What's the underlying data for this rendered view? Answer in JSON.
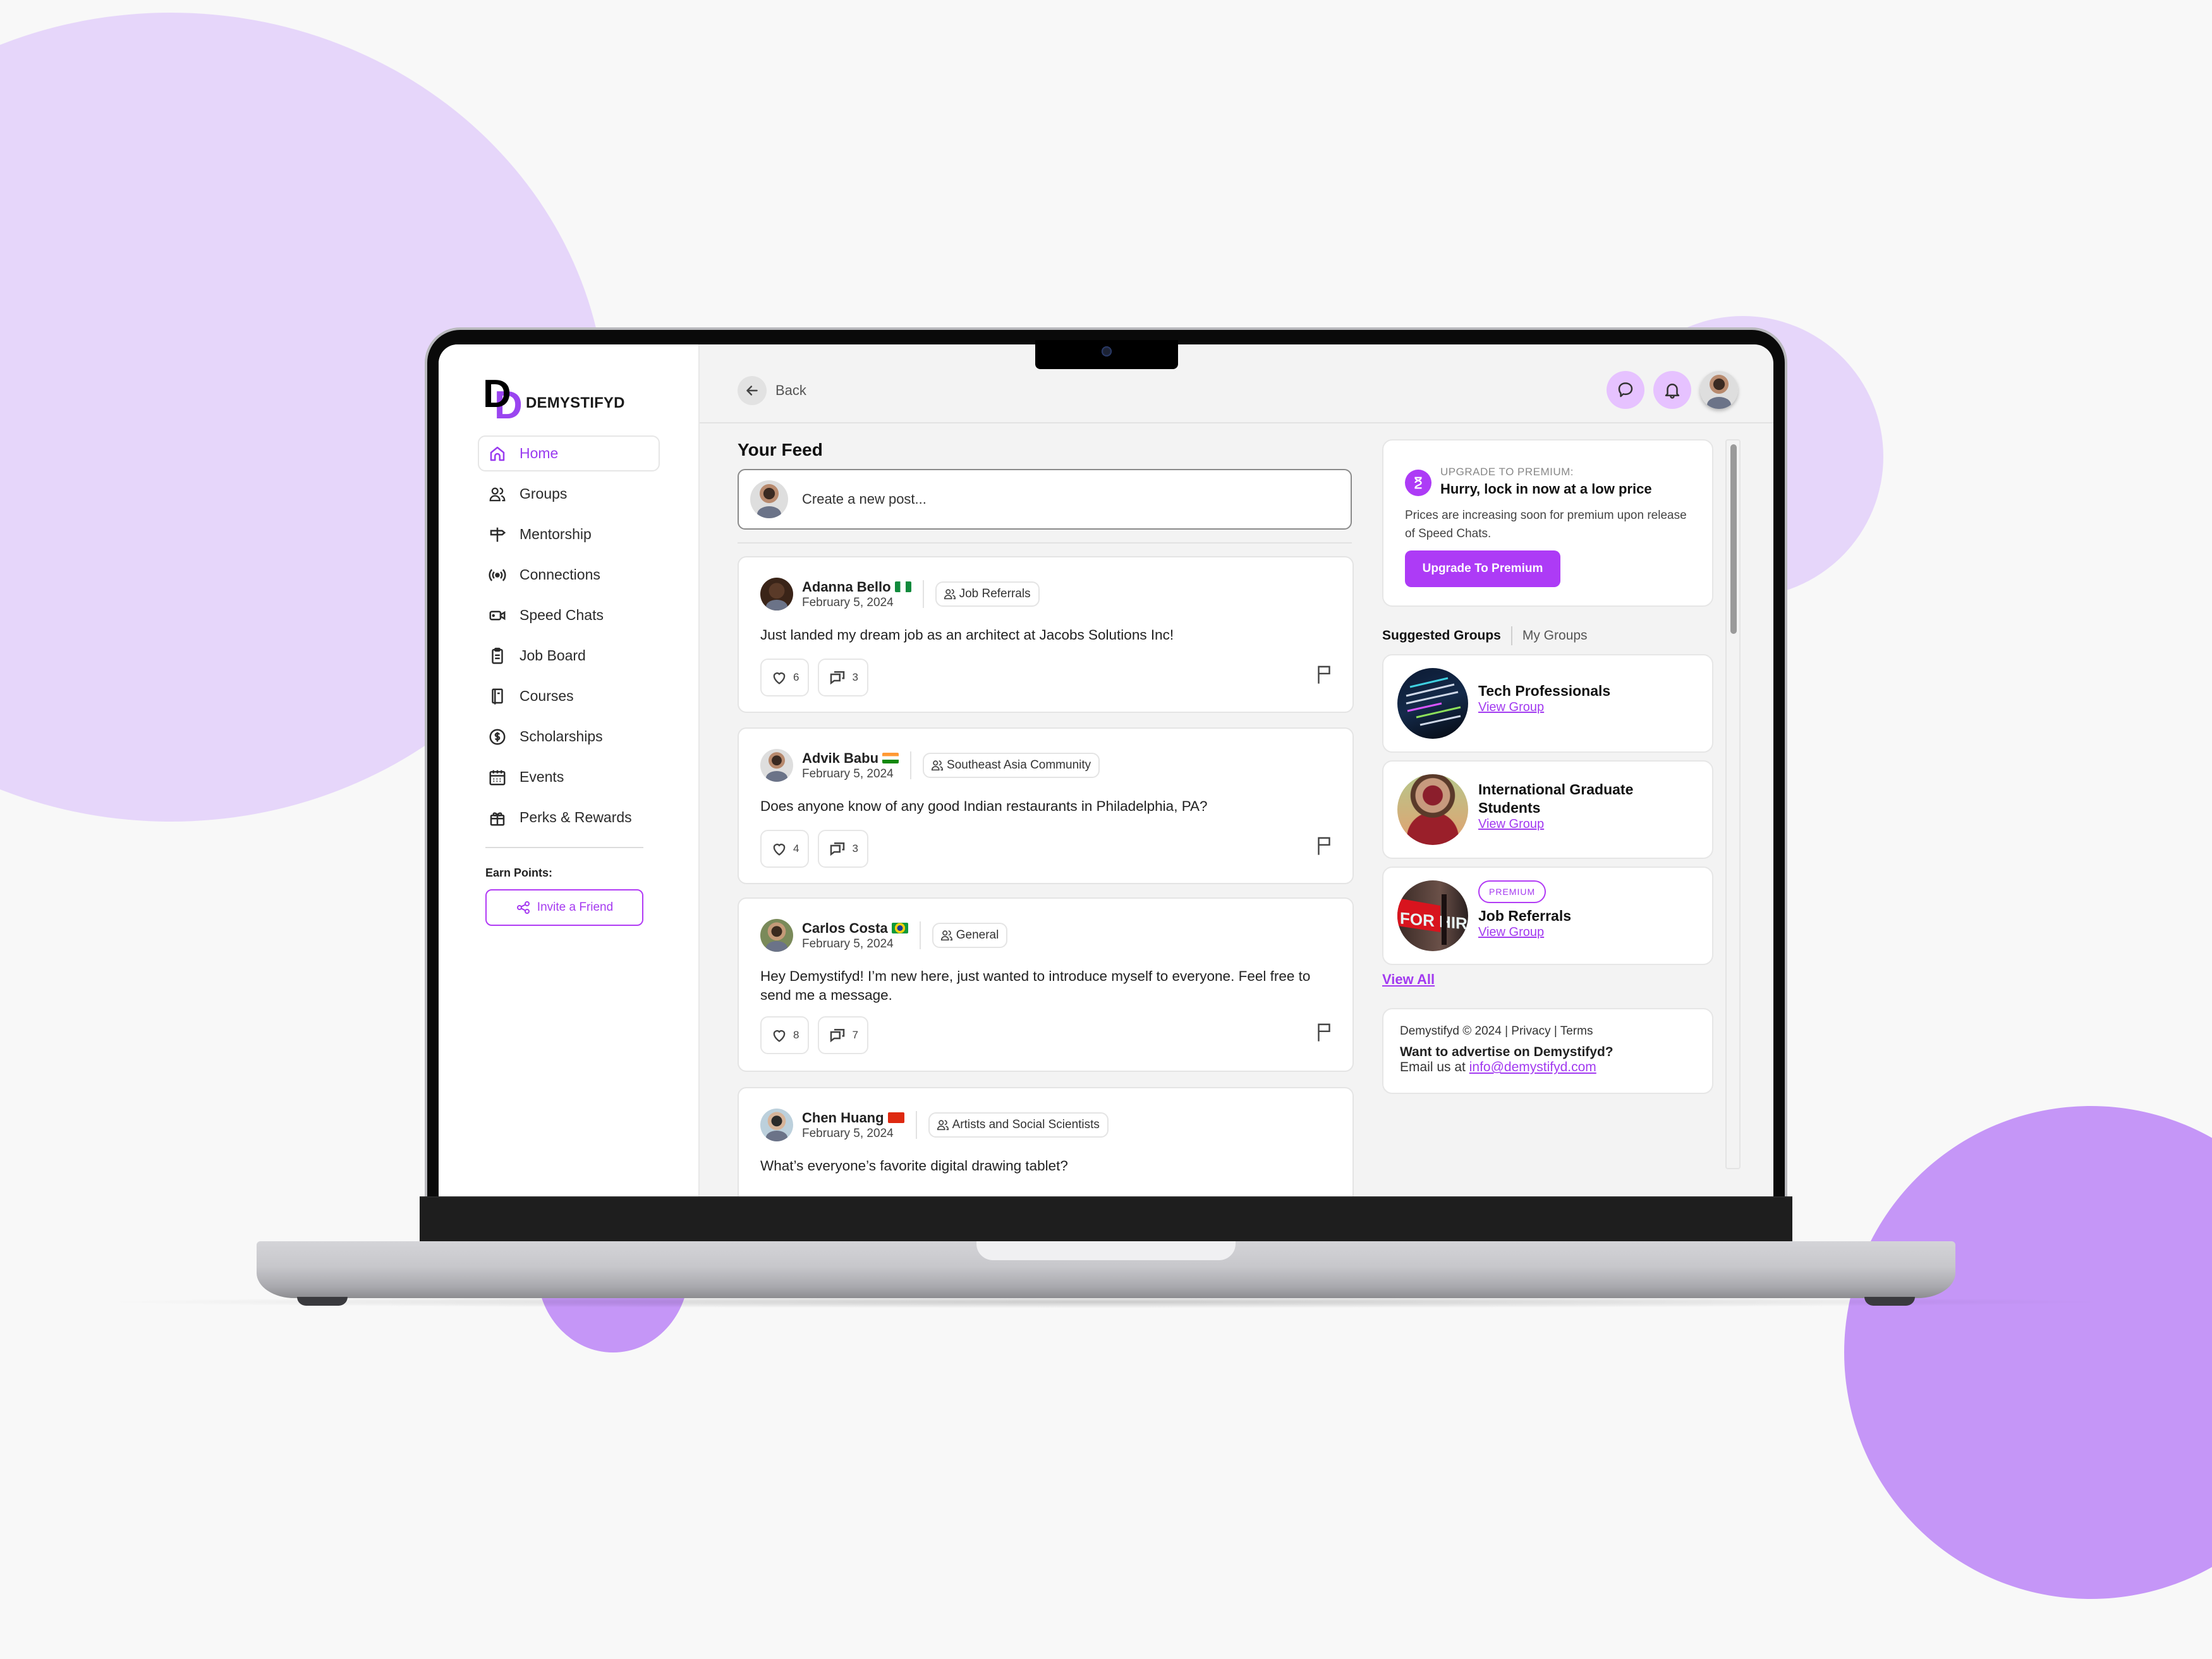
{
  "app": {
    "brand": "DEMYSTIFYD",
    "accent_color": "#ad3bf6",
    "light_accent": "#e6c2ff"
  },
  "sidebar": {
    "items": [
      {
        "label": "Home",
        "icon": "home-icon",
        "active": true
      },
      {
        "label": "Groups",
        "icon": "groups-icon"
      },
      {
        "label": "Mentorship",
        "icon": "signpost-icon"
      },
      {
        "label": "Connections",
        "icon": "broadcast-icon"
      },
      {
        "label": "Speed Chats",
        "icon": "video-icon"
      },
      {
        "label": "Job Board",
        "icon": "clipboard-icon"
      },
      {
        "label": "Courses",
        "icon": "book-icon"
      },
      {
        "label": "Scholarships",
        "icon": "dollar-icon"
      },
      {
        "label": "Events",
        "icon": "calendar-icon"
      },
      {
        "label": "Perks & Rewards",
        "icon": "gift-icon"
      }
    ],
    "earn_points_label": "Earn Points:",
    "invite_label": "Invite a Friend"
  },
  "header": {
    "back_label": "Back"
  },
  "feed": {
    "title": "Your Feed",
    "create_placeholder": "Create a new post...",
    "posts": [
      {
        "author": "Adanna Bello",
        "flag": "Nigeria",
        "date": "February 5, 2024",
        "group": "Job Referrals",
        "text": "Just landed my dream job as an architect at Jacobs Solutions Inc!",
        "likes": "6",
        "comments": "3"
      },
      {
        "author": "Advik Babu",
        "flag": "India",
        "date": "February 5, 2024",
        "group": "Southeast Asia Community",
        "text": "Does anyone know of any good Indian restaurants in Philadelphia, PA?",
        "likes": "4",
        "comments": "3"
      },
      {
        "author": "Carlos Costa",
        "flag": "Brazil",
        "date": "February 5, 2024",
        "group": "General",
        "text": "Hey Demystifyd! I’m new here, just wanted to introduce myself to everyone. Feel free to send me a message.",
        "likes": "8",
        "comments": "7"
      },
      {
        "author": "Chen Huang",
        "flag": "China",
        "date": "February 5, 2024",
        "group": "Artists and Social Scientists",
        "text": "What’s everyone’s favorite digital drawing tablet?"
      }
    ]
  },
  "promo": {
    "kicker": "UPGRADE TO PREMIUM:",
    "title": "Hurry, lock in now at a low price",
    "text": "Prices are increasing soon for premium upon release of Speed Chats.",
    "button": "Upgrade To Premium"
  },
  "groups": {
    "tab_active": "Suggested Groups",
    "tab_other": "My Groups",
    "items": [
      {
        "name": "Tech Professionals",
        "link": "View Group"
      },
      {
        "name": "International Graduate Students",
        "link": "View Group"
      },
      {
        "name": "Job Referrals",
        "link": "View Group",
        "badge": "PREMIUM"
      }
    ],
    "view_all": "View All"
  },
  "footer": {
    "copyright": "Demystifyd © 2024 | Privacy | Terms",
    "advertise": "Want to advertise on Demystifyd?",
    "email_prefix": "Email us at ",
    "email": "info@demystifyd.com"
  }
}
